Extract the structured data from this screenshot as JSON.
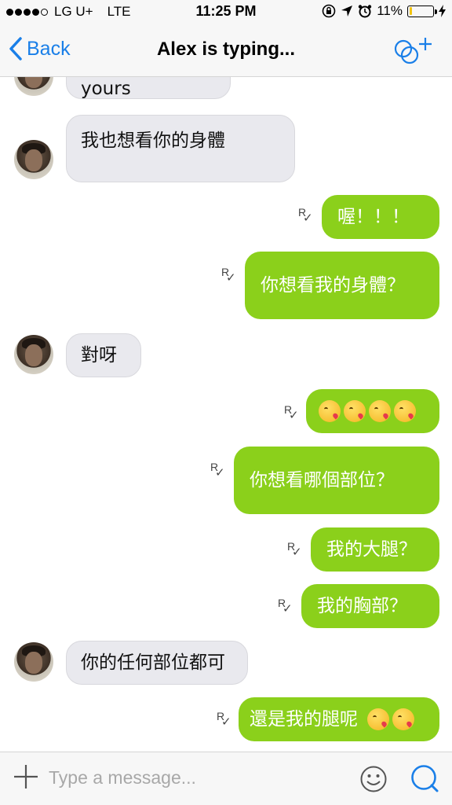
{
  "status_bar": {
    "carrier": "LG U+",
    "network": "LTE",
    "time": "11:25 PM",
    "battery_percent": "11%",
    "battery_level": 0.11
  },
  "nav": {
    "back_label": "Back",
    "title": "Alex is typing..."
  },
  "messages": [
    {
      "side": "in",
      "text": "Send me yours"
    },
    {
      "side": "in",
      "text": "我也想看你的身體"
    },
    {
      "side": "out",
      "text": "喔！！！",
      "read_mark": "R"
    },
    {
      "side": "out",
      "text": "你想看我的身體？",
      "read_mark": "R"
    },
    {
      "side": "in",
      "text": "對呀"
    },
    {
      "side": "out",
      "text": "",
      "emoji": [
        "kissing-heart-emoji",
        "kissing-heart-emoji",
        "kissing-heart-emoji",
        "kissing-heart-emoji"
      ],
      "read_mark": "R"
    },
    {
      "side": "out",
      "text": "你想看哪個部位？",
      "read_mark": "R"
    },
    {
      "side": "out",
      "text": "我的大腿？",
      "read_mark": "R"
    },
    {
      "side": "out",
      "text": "我的胸部？",
      "read_mark": "R"
    },
    {
      "side": "in",
      "text": "你的任何部位都可"
    },
    {
      "side": "out",
      "text": "還是我的腿呢",
      "emoji": [
        "kissing-heart-emoji",
        "kissing-heart-emoji"
      ],
      "read_mark": "R"
    }
  ],
  "composer": {
    "placeholder": "Type a message..."
  },
  "colors": {
    "accent": "#1a7fe8",
    "outgoing_bubble": "#8bd01b",
    "incoming_bubble": "#e9e9ee"
  }
}
